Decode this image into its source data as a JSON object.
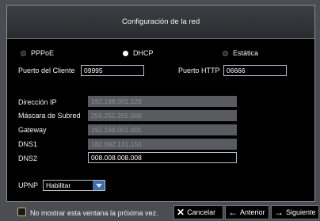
{
  "title": "Configuración de la red",
  "modes": [
    {
      "label": "PPPoE",
      "selected": false
    },
    {
      "label": "DHCP",
      "selected": true
    },
    {
      "label": "Estática",
      "selected": false
    }
  ],
  "client_port": {
    "label": "Puerto del Cliente",
    "value": "09995"
  },
  "http_port": {
    "label": "Puerto HTTP",
    "value": "06666"
  },
  "ip": {
    "label": "Dirección IP",
    "value": "192.168.001.129"
  },
  "mask": {
    "label": "Máscara de Subred",
    "value": "255.255.255.000"
  },
  "gateway": {
    "label": "Gateway",
    "value": "192.168.001.001"
  },
  "dns1": {
    "label": "DNS1",
    "value": "182.092.131.150"
  },
  "dns2": {
    "label": "DNS2",
    "value": "008.008.008.008"
  },
  "upnp": {
    "label": "UPNP",
    "value": "Habilitar"
  },
  "footer": {
    "checkbox_label": "No mostrar esta ventana la próxima vez.",
    "cancel_label": "Cancelar",
    "cancel_icon": "x-icon",
    "prev_label": "Anterior",
    "prev_icon": "arrow-left-icon",
    "next_label": "Siguiente",
    "next_icon": "arrow-right-icon"
  },
  "colors": {
    "background": "#4b4d52",
    "panel": "#000000",
    "disabled_field": "#585b60",
    "checkbox_border": "#d7b64a",
    "dropdown_accent": "#3d6ea8"
  }
}
